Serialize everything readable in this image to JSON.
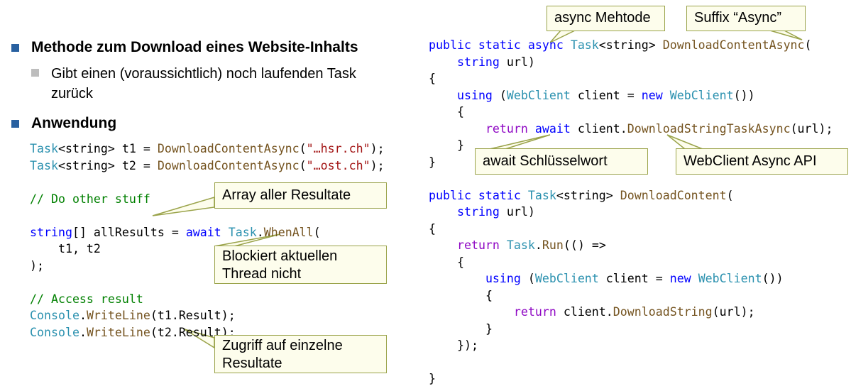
{
  "left": {
    "heading1": "Methode zum Download eines Website-Inhalts",
    "sub1_line1": "Gibt einen (voraussichtlich) noch laufenden Task",
    "sub1_line2": "zurück",
    "heading2": "Anwendung"
  },
  "left_code": {
    "l1": {
      "type": "Task",
      "generic": "<string>",
      "rest": " t1 = ",
      "fn": "DownloadContentAsync",
      "open": "(",
      "str": "\"…hsr.ch\"",
      "close": ");"
    },
    "l2": {
      "type": "Task",
      "generic": "<string>",
      "rest": " t2 = ",
      "fn": "DownloadContentAsync",
      "open": "(",
      "str": "\"…ost.ch\"",
      "close": ");"
    },
    "comment1": "// Do other stuff",
    "l4_kw": "string",
    "l4_rest": "[] allResults = ",
    "l4_await": "await",
    "l4_type": "Task",
    "l4_dot": ".",
    "l4_fn": "WhenAll",
    "l4_open": "(",
    "l5": "    t1, t2",
    "l6": ");",
    "comment2": "// Access result",
    "l8_type": "Console",
    "l8_dot": ".",
    "l8_fn": "WriteLine",
    "l8_rest": "(t1.Result);",
    "l9_type": "Console",
    "l9_dot": ".",
    "l9_fn": "WriteLine",
    "l9_rest": "(t2.Result);"
  },
  "right_code": {
    "sig1_kw": "public static async",
    "sig1_type": "Task",
    "sig1_gen": "<string>",
    "sig1_fn": "DownloadContentAsync",
    "sig1_open": "(",
    "param_kw": "string",
    "param_rest": " url)",
    "brace_open": "{",
    "using_kw": "using",
    "using_open": " (",
    "wc_type": "WebClient",
    "client_eq": " client = ",
    "new_kw": "new",
    "wc_type2": "WebClient",
    "using_close": "())",
    "inner_open": "{",
    "return_kw": "return",
    "await_kw": "await",
    "ret_client": " client.",
    "ret_fn": "DownloadStringTaskAsync",
    "ret_rest": "(url);",
    "inner_close": "}",
    "brace_close": "}",
    "sig2_kw": "public static",
    "sig2_type": "Task",
    "sig2_gen": "<string>",
    "sig2_fn": "DownloadContent",
    "sig2_open": "(",
    "param2_kw": "string",
    "param2_rest": " url)",
    "b2_open": "{",
    "ret2_kw": "return",
    "ret2_type": "Task",
    "ret2_dot": ".",
    "ret2_fn": "Run",
    "ret2_rest": "(() =>",
    "lam_open": "{",
    "using2_kw": "using",
    "using2_open": " (",
    "wc2_type": "WebClient",
    "client2_eq": " client = ",
    "new2_kw": "new",
    "wc2_type2": "WebClient",
    "using2_close": "())",
    "in2_open": "{",
    "ret3_kw": "return",
    "ret3_client": " client.",
    "ret3_fn": "DownloadString",
    "ret3_rest": "(url);",
    "in2_close": "}",
    "lam_close": "});",
    "b2_close": "}"
  },
  "callouts": {
    "async_method": "async Mehtode",
    "suffix_async": "Suffix “Async”",
    "await_keyword": "await Schlüsselwort",
    "webclient_api": "WebClient Async API",
    "array_results": "Array aller Resultate",
    "blocks_line1": "Blockiert aktuellen",
    "blocks_line2": "Thread nicht",
    "access_line1": "Zugriff auf einzelne",
    "access_line2": "Resultate"
  },
  "colors": {
    "bullet_primary": "#2860a0",
    "bullet_secondary": "#bdbdbd",
    "callout_fill": "#fdfdec",
    "callout_border": "#9aa34a",
    "keyword": "#0000ff",
    "type": "#2b91af",
    "method": "#74531f",
    "comment": "#008000",
    "string": "#a31515"
  }
}
